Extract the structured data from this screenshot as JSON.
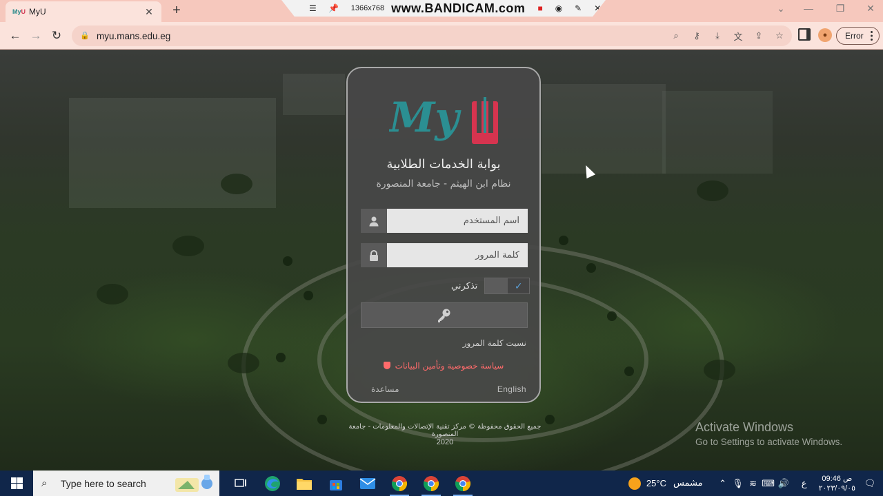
{
  "browser": {
    "tab_title": "MyU",
    "favicon_text": "My",
    "favicon_accent": "U",
    "url": "myu.mans.edu.eg",
    "error_label": "Error"
  },
  "recorder": {
    "resolution": "1366x768",
    "brand": "www.BANDICAM.com"
  },
  "login": {
    "title": "بوابة الخدمات الطلابية",
    "subtitle": "نظام ابن الهيثم - جامعة المنصورة",
    "username_placeholder": "اسم المستخدم",
    "password_placeholder": "كلمة المرور",
    "remember_label": "تذكرني",
    "forgot_label": "نسيت كلمة المرور",
    "privacy_label": "سياسة خصوصية وتأمين البيانات",
    "help_label": "مساعدة",
    "language_label": "English",
    "logo_text": "MyU",
    "brand_teal": "#2b8f92",
    "brand_red": "#d6344f"
  },
  "footer": {
    "rights": "جميع الحقوق محفوظة © مركز تقنية الإتصالات والمعلومات - جامعة المنصورة",
    "year": "2020"
  },
  "watermark": {
    "line1": "Activate Windows",
    "line2": "Go to Settings to activate Windows."
  },
  "taskbar": {
    "search_placeholder": "Type here to search",
    "weather_temp": "25°C",
    "weather_desc": "مشمس",
    "input_lang": "ع",
    "time": "09:46 ص",
    "date": "٢٠٢٣/٠٩/٠٥",
    "apps": [
      "task-view-icon",
      "edge-icon",
      "file-explorer-icon",
      "store-icon",
      "mail-icon",
      "chrome-icon",
      "chrome-icon",
      "chrome-icon"
    ]
  }
}
